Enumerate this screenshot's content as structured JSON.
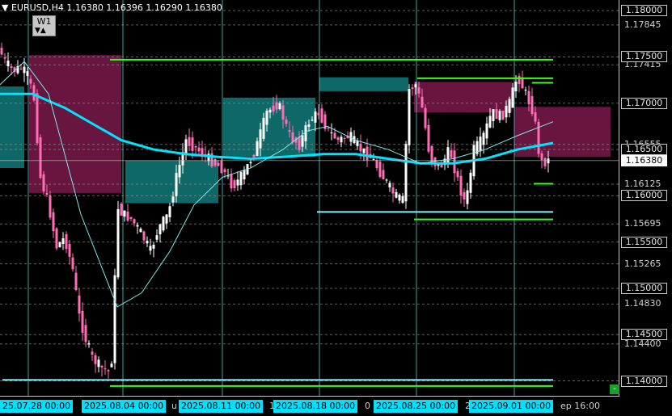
{
  "header": {
    "title": "EURUSD,H4",
    "ohlc": "1.16380 1.16396 1.16290 1.16380",
    "menu_icon": "triangle-down-icon"
  },
  "timeframe_button": {
    "label": "W1",
    "down_icon": "triangle-down-icon",
    "up_icon": "triangle-up-icon"
  },
  "price_axis": {
    "boxed_levels": [
      "1.18000",
      "1.17500",
      "1.17000",
      "1.16500",
      "1.16000",
      "1.15500",
      "1.15000",
      "1.14500",
      "1.14000"
    ],
    "current_price": "1.16380",
    "plain_labels": [
      "1.17845",
      "1.17415",
      "1.16555",
      "1.16125",
      "1.15695",
      "1.15265",
      "1.14830",
      "1.14400"
    ]
  },
  "time_axis": {
    "highlighted": [
      "2025.08.04 00:00",
      "2025.08.11 00:00",
      "2025.08.18 00:00",
      "2025.08.25 00:00",
      "2025.09.01 00:00"
    ],
    "partial_left": "25.07.28 00:00",
    "fragments": [
      "u",
      "1",
      "0",
      "2",
      "ep 16:00"
    ]
  },
  "colors": {
    "background": "#000000",
    "bull_candle": "#ffffff",
    "bear_candle": "#ff6eb4",
    "supply_zone": "#7a1a4a",
    "demand_zone": "#127a7a",
    "ma_slow": "#00e5ff",
    "ma_fast": "#7fe8e8",
    "level_green": "#39ff14",
    "level_cyan": "#7ff5ff",
    "grid_vertical": "#5fd3d3",
    "grid_horizontal": "#8a8a8a"
  },
  "chart_data": {
    "type": "candlestick",
    "symbol": "EURUSD",
    "timeframe": "H4",
    "ylim": [
      1.13935,
      1.18045
    ],
    "yticks": [
      1.18,
      1.17845,
      1.175,
      1.17415,
      1.17,
      1.16555,
      1.165,
      1.16125,
      1.16,
      1.15695,
      1.155,
      1.15265,
      1.15,
      1.1483,
      1.145,
      1.144,
      1.14
    ],
    "week_separators": [
      "2025.07.28 00:00",
      "2025.08.04 00:00",
      "2025.08.11 00:00",
      "2025.08.18 00:00",
      "2025.08.25 00:00",
      "2025.09.01 00:00"
    ],
    "path": [
      [
        0,
        1.176
      ],
      [
        8,
        1.1745
      ],
      [
        18,
        1.1735
      ],
      [
        28,
        1.1738
      ],
      [
        36,
        1.173
      ],
      [
        44,
        1.1705
      ],
      [
        52,
        1.162
      ],
      [
        62,
        1.159
      ],
      [
        72,
        1.1545
      ],
      [
        82,
        1.1555
      ],
      [
        92,
        1.152
      ],
      [
        100,
        1.147
      ],
      [
        108,
        1.1445
      ],
      [
        116,
        1.1425
      ],
      [
        126,
        1.1415
      ],
      [
        136,
        1.141
      ],
      [
        142,
        1.143
      ],
      [
        146,
        1.159
      ],
      [
        154,
        1.158
      ],
      [
        164,
        1.1575
      ],
      [
        176,
        1.156
      ],
      [
        188,
        1.154
      ],
      [
        198,
        1.1565
      ],
      [
        210,
        1.158
      ],
      [
        220,
        1.162
      ],
      [
        232,
        1.166
      ],
      [
        246,
        1.165
      ],
      [
        260,
        1.164
      ],
      [
        276,
        1.163
      ],
      [
        290,
        1.161
      ],
      [
        304,
        1.1625
      ],
      [
        318,
        1.165
      ],
      [
        332,
        1.169
      ],
      [
        346,
        1.17
      ],
      [
        360,
        1.1665
      ],
      [
        372,
        1.1655
      ],
      [
        384,
        1.168
      ],
      [
        396,
        1.169
      ],
      [
        408,
        1.167
      ],
      [
        420,
        1.166
      ],
      [
        434,
        1.1665
      ],
      [
        448,
        1.165
      ],
      [
        462,
        1.164
      ],
      [
        476,
        1.162
      ],
      [
        490,
        1.16
      ],
      [
        500,
        1.1595
      ],
      [
        508,
        1.1715
      ],
      [
        516,
        1.172
      ],
      [
        524,
        1.1695
      ],
      [
        534,
        1.164
      ],
      [
        546,
        1.163
      ],
      [
        558,
        1.165
      ],
      [
        570,
        1.161
      ],
      [
        578,
        1.159
      ],
      [
        588,
        1.165
      ],
      [
        598,
        1.166
      ],
      [
        610,
        1.169
      ],
      [
        622,
        1.1685
      ],
      [
        632,
        1.17
      ],
      [
        642,
        1.173
      ],
      [
        652,
        1.171
      ],
      [
        662,
        1.169
      ],
      [
        670,
        1.1635
      ],
      [
        678,
        1.1638
      ]
    ],
    "moving_averages": [
      {
        "name": "",
        "style": "thick",
        "color": "#00e5ff",
        "points": [
          [
            0,
            1.171
          ],
          [
            40,
            1.171
          ],
          [
            80,
            1.1695
          ],
          [
            120,
            1.1675
          ],
          [
            150,
            1.166
          ],
          [
            190,
            1.165
          ],
          [
            230,
            1.1645
          ],
          [
            270,
            1.1642
          ],
          [
            310,
            1.164
          ],
          [
            350,
            1.1642
          ],
          [
            400,
            1.1645
          ],
          [
            440,
            1.1645
          ],
          [
            480,
            1.164
          ],
          [
            520,
            1.1635
          ],
          [
            560,
            1.1635
          ],
          [
            600,
            1.164
          ],
          [
            640,
            1.165
          ],
          [
            684,
            1.1657
          ]
        ]
      },
      {
        "name": "",
        "style": "thin",
        "color": "#7fe8e8",
        "points": [
          [
            0,
            1.172
          ],
          [
            30,
            1.1745
          ],
          [
            60,
            1.171
          ],
          [
            100,
            1.158
          ],
          [
            145,
            1.148
          ],
          [
            175,
            1.1495
          ],
          [
            210,
            1.154
          ],
          [
            240,
            1.159
          ],
          [
            275,
            1.162
          ],
          [
            310,
            1.163
          ],
          [
            350,
            1.165
          ],
          [
            380,
            1.167
          ],
          [
            405,
            1.1675
          ],
          [
            440,
            1.166
          ],
          [
            480,
            1.165
          ],
          [
            520,
            1.1635
          ],
          [
            560,
            1.164
          ],
          [
            600,
            1.165
          ],
          [
            640,
            1.1665
          ],
          [
            684,
            1.168
          ]
        ]
      }
    ],
    "zones": [
      {
        "kind": "supply",
        "x": [
          36,
          150
        ],
        "y": [
          1.1603,
          1.1752
        ]
      },
      {
        "kind": "demand",
        "x": [
          0,
          30
        ],
        "y": [
          1.163,
          1.1718
        ]
      },
      {
        "kind": "demand",
        "x": [
          155,
          270
        ],
        "y": [
          1.1592,
          1.1638
        ]
      },
      {
        "kind": "demand",
        "x": [
          276,
          390
        ],
        "y": [
          1.1642,
          1.1706
        ]
      },
      {
        "kind": "demand",
        "x": [
          395,
          505
        ],
        "y": [
          1.1713,
          1.1728
        ]
      },
      {
        "kind": "supply",
        "x": [
          512,
          633
        ],
        "y": [
          1.169,
          1.1723
        ]
      },
      {
        "kind": "supply",
        "x": [
          636,
          755
        ],
        "y": [
          1.1642,
          1.1696
        ]
      }
    ],
    "levels": [
      {
        "color": "#39ff14",
        "x": [
          136,
          684
        ],
        "y": 1.1747
      },
      {
        "color": "#39ff14",
        "x": [
          516,
          684
        ],
        "y": 1.1727
      },
      {
        "color": "#39ff14",
        "x": [
          658,
          684
        ],
        "y": 1.1722
      },
      {
        "color": "#39ff14",
        "x": [
          660,
          684
        ],
        "y": 1.1613
      },
      {
        "color": "#7ff5ff",
        "x": [
          392,
          684
        ],
        "y": 1.15825
      },
      {
        "color": "#39ff14",
        "x": [
          512,
          684
        ],
        "y": 1.15745
      },
      {
        "color": "#7ff5ff",
        "x": [
          3,
          684
        ],
        "y": 1.1401
      },
      {
        "color": "#39ff14",
        "x": [
          136,
          684
        ],
        "y": 1.13945
      }
    ]
  }
}
